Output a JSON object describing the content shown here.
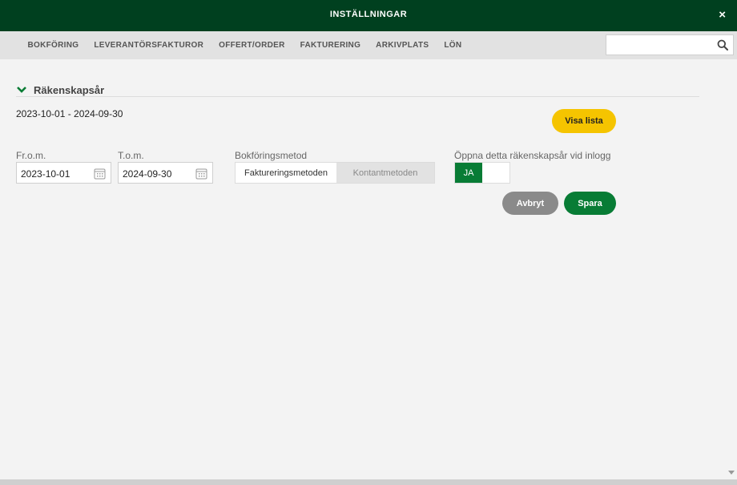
{
  "window": {
    "title": "INSTÄLLNINGAR",
    "close_label": "×"
  },
  "nav": {
    "items": [
      "BOKFÖRING",
      "LEVERANTÖRSFAKTUROR",
      "OFFERT/ORDER",
      "FAKTURERING",
      "ARKIVPLATS",
      "LÖN"
    ],
    "search": {
      "value": "",
      "placeholder": "",
      "icon": "search-icon"
    }
  },
  "section": {
    "title": "Räkenskapsår",
    "icon": "chevron-down-icon",
    "current_range": "2023-10-01 - 2024-09-30",
    "list_button": "Visa lista"
  },
  "form": {
    "from_label": "Fr.o.m.",
    "from_value": "2023-10-01",
    "to_label": "T.o.m.",
    "to_value": "2024-09-30",
    "method_label": "Bokföringsmetod",
    "method_options": [
      "Faktureringsmetoden",
      "Kontantmetoden"
    ],
    "method_selected": "Faktureringsmetoden",
    "open_label": "Öppna detta räkenskapsår vid inlogg",
    "open_toggle_value": "JA"
  },
  "actions": {
    "cancel": "Avbryt",
    "save": "Spara"
  },
  "colors": {
    "header_bg": "#00401f",
    "accent_green": "#087c35",
    "yellow_button": "#f5c400",
    "cancel_gray": "#8a8a8a"
  }
}
